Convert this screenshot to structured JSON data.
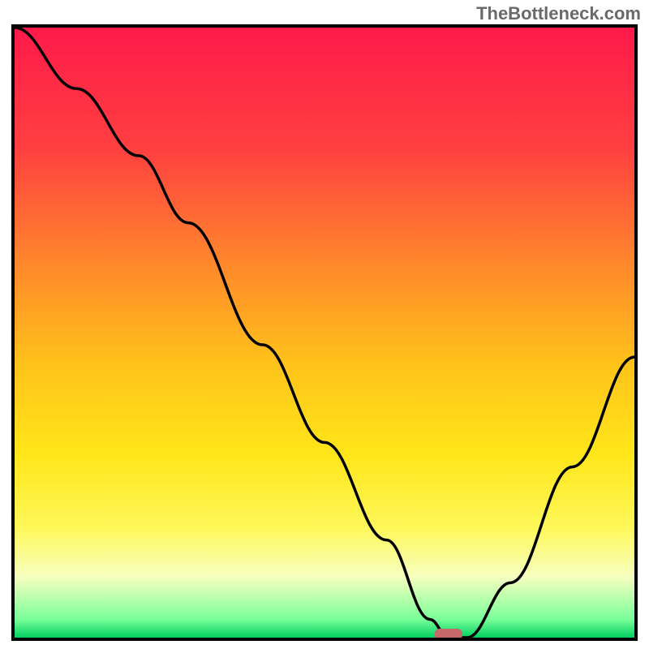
{
  "watermark": "TheBottleneck.com",
  "chart_data": {
    "type": "line",
    "title": "",
    "xlabel": "",
    "ylabel": "",
    "xlim": [
      0,
      100
    ],
    "ylim": [
      0,
      100
    ],
    "x": [
      0,
      10,
      20,
      28,
      40,
      50,
      60,
      67,
      70,
      73,
      80,
      90,
      100
    ],
    "values": [
      100,
      90,
      79,
      68,
      48,
      32,
      16,
      3,
      0,
      0,
      9,
      28,
      46
    ],
    "marker": {
      "x": 70,
      "y": 0,
      "color": "#c46a6a"
    },
    "background_gradient": {
      "stops": [
        {
          "offset": 0,
          "color": "#ff1a4a"
        },
        {
          "offset": 0.2,
          "color": "#ff4040"
        },
        {
          "offset": 0.4,
          "color": "#ff8c2a"
        },
        {
          "offset": 0.55,
          "color": "#ffc21a"
        },
        {
          "offset": 0.7,
          "color": "#ffe61a"
        },
        {
          "offset": 0.82,
          "color": "#fff85a"
        },
        {
          "offset": 0.9,
          "color": "#f7ffbf"
        },
        {
          "offset": 0.97,
          "color": "#7aff9a"
        },
        {
          "offset": 1.0,
          "color": "#00d060"
        }
      ]
    }
  }
}
